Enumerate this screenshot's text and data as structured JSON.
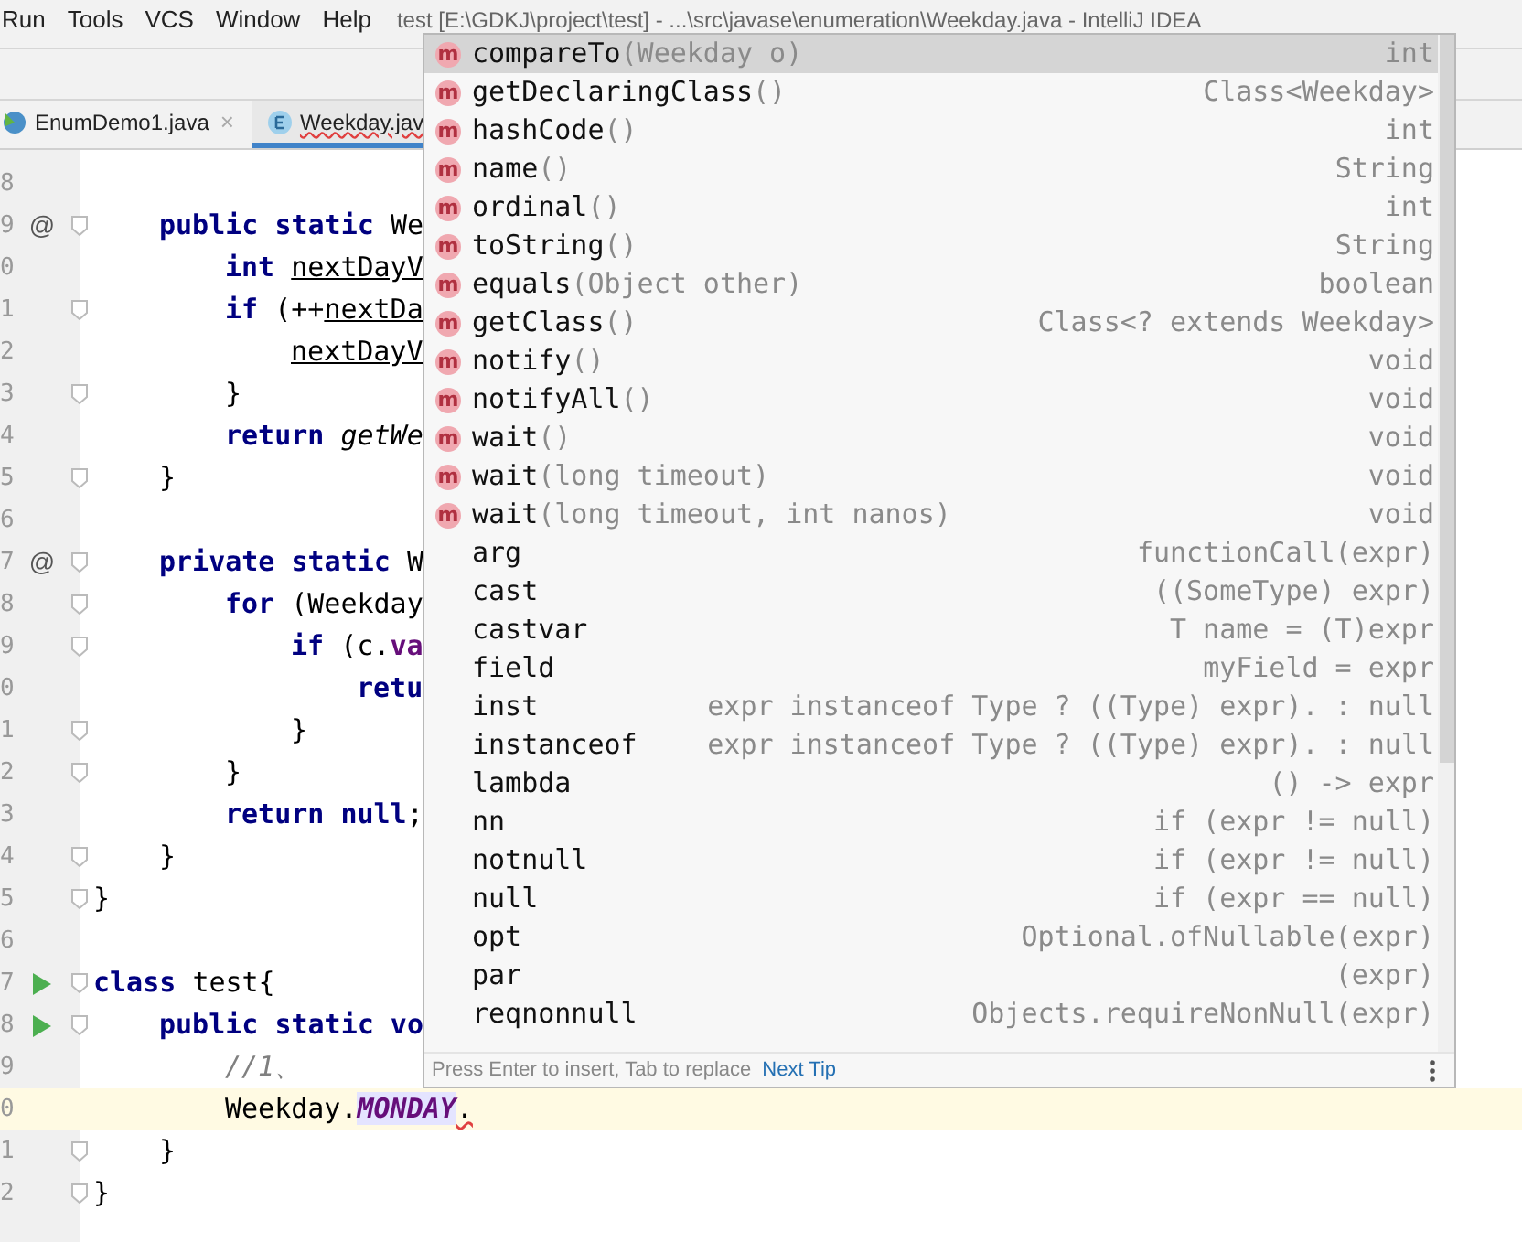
{
  "menu_bar": {
    "items": [
      "Run",
      "Tools",
      "VCS",
      "Window",
      "Help"
    ],
    "title": "test [E:\\GDKJ\\project\\test] - ...\\src\\javase\\enumeration\\Weekday.java - IntelliJ IDEA"
  },
  "tabs": [
    {
      "label": "EnumDemo1.java",
      "kind": "class",
      "selected": false,
      "error": false,
      "close": "×"
    },
    {
      "label": "Weekday.jav",
      "kind": "enum",
      "selected": true,
      "error": true
    }
  ],
  "editor": {
    "lines": [
      {
        "children": [
          {
            "number": "8",
            "run": false,
            "fold": false,
            "current": false
          },
          {
            "number": "9",
            "marker": "@",
            "run": false,
            "fold": true,
            "current": false,
            "segments": [
              {
                "kind": "kw",
                "text": "public static "
              },
              {
                "kind": "plain",
                "text": "We"
              }
            ],
            "children": [
              {
                "number": "0",
                "run": false,
                "fold": false,
                "current": false,
                "segments": [
                  {
                    "kind": "kw",
                    "text": "int "
                  },
                  {
                    "kind": "var",
                    "text": "nextDayV"
                  }
                ]
              },
              {
                "number": "1",
                "run": false,
                "fold": true,
                "current": false,
                "segments": [
                  {
                    "kind": "kw",
                    "text": "if "
                  },
                  {
                    "kind": "plain",
                    "text": "(++"
                  },
                  {
                    "kind": "var",
                    "text": "nextDa"
                  }
                ],
                "children": [
                  {
                    "number": "2",
                    "run": false,
                    "fold": false,
                    "current": false,
                    "segments": [
                      {
                        "kind": "var",
                        "text": "nextDayV"
                      }
                    ]
                  }
                ]
              },
              {
                "number": "3",
                "run": false,
                "fold": true,
                "current": false,
                "segments": [
                  {
                    "kind": "plain",
                    "text": "}"
                  }
                ]
              },
              {
                "number": "4",
                "run": false,
                "fold": false,
                "current": false,
                "segments": [
                  {
                    "kind": "kw",
                    "text": "return "
                  },
                  {
                    "kind": "call",
                    "text": "getWe"
                  }
                ]
              }
            ]
          },
          {
            "number": "5",
            "run": false,
            "fold": true,
            "current": false,
            "segments": [
              {
                "kind": "plain",
                "text": "}"
              }
            ]
          },
          {
            "number": "6",
            "run": false,
            "fold": false,
            "current": false
          },
          {
            "number": "7",
            "marker": "@",
            "run": false,
            "fold": true,
            "current": false,
            "segments": [
              {
                "kind": "kw",
                "text": "private static "
              },
              {
                "kind": "plain",
                "text": "W"
              }
            ],
            "children": [
              {
                "number": "8",
                "run": false,
                "fold": true,
                "current": false,
                "segments": [
                  {
                    "kind": "kw",
                    "text": "for "
                  },
                  {
                    "kind": "plain",
                    "text": "(Weekday"
                  }
                ],
                "children": [
                  {
                    "number": "9",
                    "run": false,
                    "fold": true,
                    "current": false,
                    "segments": [
                      {
                        "kind": "kw",
                        "text": "if "
                      },
                      {
                        "kind": "plain",
                        "text": "(c."
                      },
                      {
                        "kind": "field",
                        "text": "va"
                      }
                    ],
                    "children": [
                      {
                        "number": "0",
                        "run": false,
                        "fold": false,
                        "current": false,
                        "segments": [
                          {
                            "kind": "kw",
                            "text": "retu"
                          }
                        ]
                      }
                    ]
                  },
                  {
                    "number": "1",
                    "run": false,
                    "fold": true,
                    "current": false,
                    "segments": [
                      {
                        "kind": "plain",
                        "text": "}"
                      }
                    ]
                  }
                ]
              },
              {
                "number": "2",
                "run": false,
                "fold": true,
                "current": false,
                "segments": [
                  {
                    "kind": "plain",
                    "text": "}"
                  }
                ]
              },
              {
                "number": "3",
                "run": false,
                "fold": false,
                "current": false,
                "segments": [
                  {
                    "kind": "kw",
                    "text": "return null"
                  },
                  {
                    "kind": "plain",
                    "text": ";"
                  }
                ]
              }
            ]
          },
          {
            "number": "4",
            "run": false,
            "fold": true,
            "current": false,
            "segments": [
              {
                "kind": "plain",
                "text": "}"
              }
            ]
          }
        ]
      },
      {
        "number": "5",
        "run": false,
        "fold": true,
        "current": false,
        "segments": [
          {
            "kind": "plain",
            "text": "}"
          }
        ]
      },
      {
        "number": "6",
        "run": false,
        "fold": false,
        "current": false
      },
      {
        "number": "7",
        "run": true,
        "fold": true,
        "current": false,
        "segments": [
          {
            "kind": "kw",
            "text": "class "
          },
          {
            "kind": "plain",
            "text": "test{"
          }
        ],
        "children": [
          {
            "number": "8",
            "run": true,
            "fold": true,
            "current": false,
            "segments": [
              {
                "kind": "kw",
                "text": "public static vo"
              }
            ],
            "children": [
              {
                "number": "9",
                "run": false,
                "fold": false,
                "current": false,
                "segments": [
                  {
                    "kind": "comment",
                    "text": "//1、"
                  }
                ]
              },
              {
                "number": "0",
                "run": false,
                "fold": false,
                "current": true,
                "segments": [
                  {
                    "kind": "plain",
                    "text": "Weekday."
                  },
                  {
                    "kind": "constant",
                    "text": "MONDAY"
                  },
                  {
                    "kind": "error",
                    "text": "."
                  }
                ]
              }
            ]
          },
          {
            "number": "1",
            "run": false,
            "fold": true,
            "current": false,
            "segments": [
              {
                "kind": "plain",
                "text": "}"
              }
            ]
          }
        ]
      },
      {
        "number": "2",
        "run": false,
        "fold": true,
        "current": false,
        "segments": [
          {
            "kind": "plain",
            "text": "}"
          }
        ]
      }
    ]
  },
  "completion_popup": {
    "items": [
      {
        "kind": "method",
        "icon": "m",
        "name": "compareTo",
        "params": "(Weekday o)",
        "type": "int",
        "selected": true
      },
      {
        "kind": "method",
        "icon": "m",
        "name": "getDeclaringClass",
        "params": "()",
        "type": "Class<Weekday>",
        "selected": false
      },
      {
        "kind": "method",
        "icon": "m",
        "name": "hashCode",
        "params": "()",
        "type": "int",
        "selected": false
      },
      {
        "kind": "method",
        "icon": "m",
        "name": "name",
        "params": "()",
        "type": "String",
        "selected": false
      },
      {
        "kind": "method",
        "icon": "m",
        "name": "ordinal",
        "params": "()",
        "type": "int",
        "selected": false
      },
      {
        "kind": "method",
        "icon": "m",
        "name": "toString",
        "params": "()",
        "type": "String",
        "selected": false
      },
      {
        "kind": "method",
        "icon": "m",
        "name": "equals",
        "params": "(Object other)",
        "type": "boolean",
        "selected": false
      },
      {
        "kind": "method",
        "icon": "m",
        "name": "getClass",
        "params": "()",
        "type": "Class<? extends Weekday>",
        "selected": false
      },
      {
        "kind": "method",
        "icon": "m",
        "name": "notify",
        "params": "()",
        "type": "void",
        "selected": false
      },
      {
        "kind": "method",
        "icon": "m",
        "name": "notifyAll",
        "params": "()",
        "type": "void",
        "selected": false
      },
      {
        "kind": "method",
        "icon": "m",
        "name": "wait",
        "params": "()",
        "type": "void",
        "selected": false
      },
      {
        "kind": "method",
        "icon": "m",
        "name": "wait",
        "params": "(long timeout)",
        "type": "void",
        "selected": false
      },
      {
        "kind": "method",
        "icon": "m",
        "name": "wait",
        "params": "(long timeout, int nanos)",
        "type": "void",
        "selected": false
      },
      {
        "kind": "template",
        "name": "arg",
        "type": "functionCall(expr)",
        "selected": false
      },
      {
        "kind": "template",
        "name": "cast",
        "type": "((SomeType) expr)",
        "selected": false
      },
      {
        "kind": "template",
        "name": "castvar",
        "type": "T name = (T)expr",
        "selected": false
      },
      {
        "kind": "template",
        "name": "field",
        "type": "myField = expr",
        "selected": false
      },
      {
        "kind": "template",
        "name": "inst",
        "type": "expr instanceof Type ? ((Type) expr). : null",
        "selected": false
      },
      {
        "kind": "template",
        "name": "instanceof",
        "type": "expr instanceof Type ? ((Type) expr). : null",
        "selected": false
      },
      {
        "kind": "template",
        "name": "lambda",
        "type": "() -> expr",
        "selected": false
      },
      {
        "kind": "template",
        "name": "nn",
        "type": "if (expr != null)",
        "selected": false
      },
      {
        "kind": "template",
        "name": "notnull",
        "type": "if (expr != null)",
        "selected": false
      },
      {
        "kind": "template",
        "name": "null",
        "type": "if (expr == null)",
        "selected": false
      },
      {
        "kind": "template",
        "name": "opt",
        "type": "Optional.ofNullable(expr)",
        "selected": false
      },
      {
        "kind": "template",
        "name": "par",
        "type": "(expr)",
        "selected": false
      },
      {
        "kind": "template",
        "name": "reqnonnull",
        "type": "Objects.requireNonNull(expr)",
        "selected": false
      }
    ],
    "hint": "Press Enter to insert, Tab to replace",
    "link": "Next Tip"
  }
}
